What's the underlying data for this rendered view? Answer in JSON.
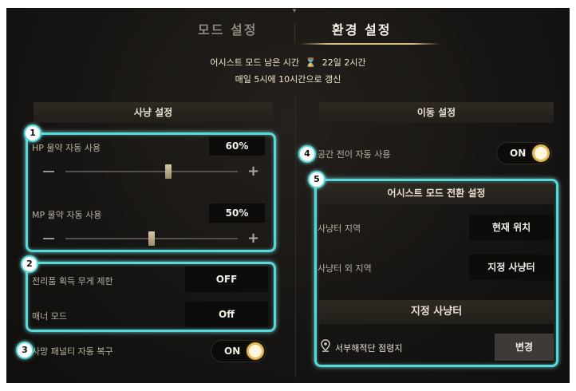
{
  "tabs": {
    "mode": "모드 설정",
    "env": "환경 설정"
  },
  "assist": {
    "label": "어시스트 모드 남은 시간",
    "hourglass_icon": "⌛",
    "remaining": "22일 2시간",
    "refresh": "매일 5시에 10시간으로 갱신"
  },
  "hunting": {
    "title": "사냥 설정",
    "hp": {
      "label": "HP 물약 자동 사용",
      "value": "60%",
      "level": 0.6
    },
    "mp": {
      "label": "MP 물약 자동 사용",
      "value": "50%",
      "level": 0.5
    },
    "loot": {
      "label": "전리품 획득 무게 제한",
      "value": "OFF"
    },
    "manner": {
      "label": "매너 모드",
      "value": "Off"
    },
    "penalty": {
      "label": "사망 패널티 자동 복구",
      "value": "ON"
    }
  },
  "movement": {
    "title": "이동 설정",
    "teleport": {
      "label": "공간 전이 자동 사용",
      "value": "ON"
    },
    "assist_switch": {
      "title": "어시스트 모드 전환 설정",
      "in_area": {
        "label": "사냥터 지역",
        "value": "현재 위치"
      },
      "out_area": {
        "label": "사냥터 외 지역",
        "value": "지정 사냥터"
      }
    },
    "designated": {
      "title": "지정 사냥터",
      "location": "서부해적단 점령지",
      "change": "변경"
    }
  },
  "callouts": [
    "1",
    "2",
    "3",
    "4",
    "5"
  ],
  "colors": {
    "highlight": "#59d8d8",
    "toggle_on": "#e2b84f",
    "tab_underline": "#d8bc86"
  }
}
